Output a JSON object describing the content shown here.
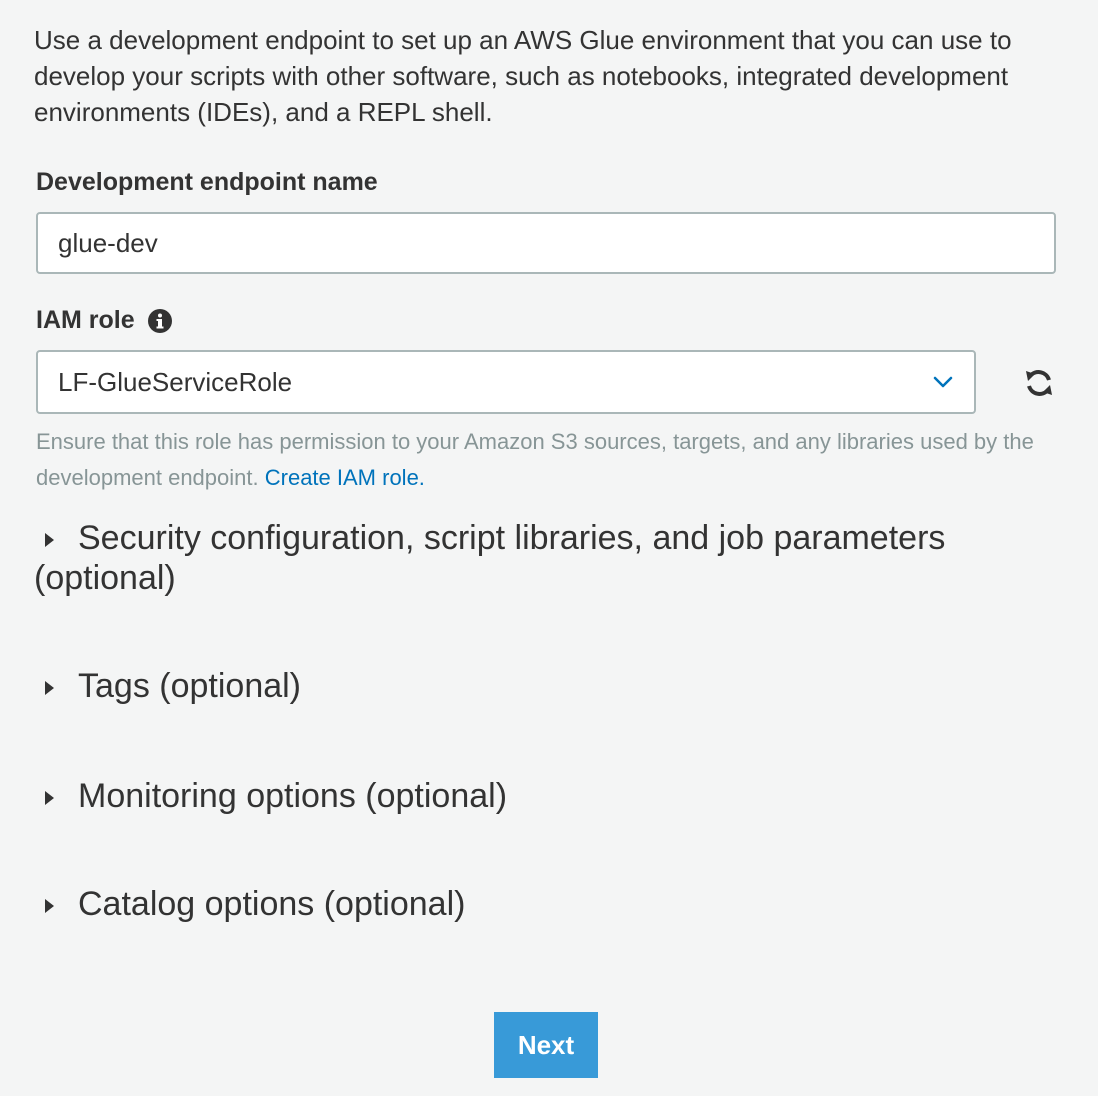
{
  "intro": {
    "text": "Use a development endpoint to set up an AWS Glue environment that you can use to develop your scripts with other software, such as notebooks, integrated development environments (IDEs), and a REPL shell."
  },
  "endpoint_name": {
    "label": "Development endpoint name",
    "value": "glue-dev"
  },
  "iam_role": {
    "label": "IAM role",
    "selected": "LF-GlueServiceRole",
    "info_icon": "info-circle-icon",
    "refresh_icon": "refresh-icon",
    "help_text": "Ensure that this role has permission to your Amazon S3 sources, targets, and any libraries used by the development endpoint.",
    "help_link": "Create IAM role."
  },
  "sections": [
    {
      "title": "Security configuration, script libraries, and job parameters (optional)"
    },
    {
      "title": "Tags (optional)"
    },
    {
      "title": "Monitoring options (optional)"
    },
    {
      "title": "Catalog options (optional)"
    }
  ],
  "actions": {
    "next_label": "Next"
  },
  "colors": {
    "background": "#f4f5f5",
    "primary_button": "#389ad8",
    "link": "#0073bb",
    "help_text": "#879596"
  }
}
